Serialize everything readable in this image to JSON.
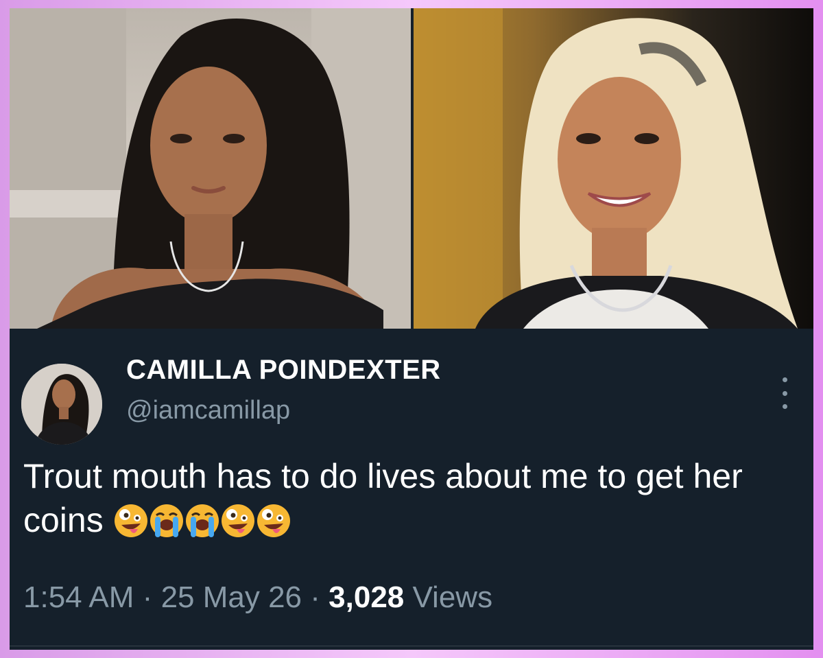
{
  "tweet": {
    "display_name": "CAMILLA POINDEXTER",
    "handle": "@iamcamillap",
    "text": "Trout mouth has to do lives about me to get her coins",
    "emojis": [
      "zany-face",
      "loudly-crying-face",
      "loudly-crying-face",
      "zany-face",
      "zany-face"
    ],
    "time": "1:54 AM",
    "separator": "·",
    "date": "25 May 26",
    "views_count": "3,028",
    "views_label": "Views"
  },
  "colors": {
    "background": "#15202b",
    "name": "#ffffff",
    "secondary_text": "#8899a6",
    "frame_border": "#e38ff0"
  },
  "icons": {
    "more": "more-vertical-icon"
  }
}
